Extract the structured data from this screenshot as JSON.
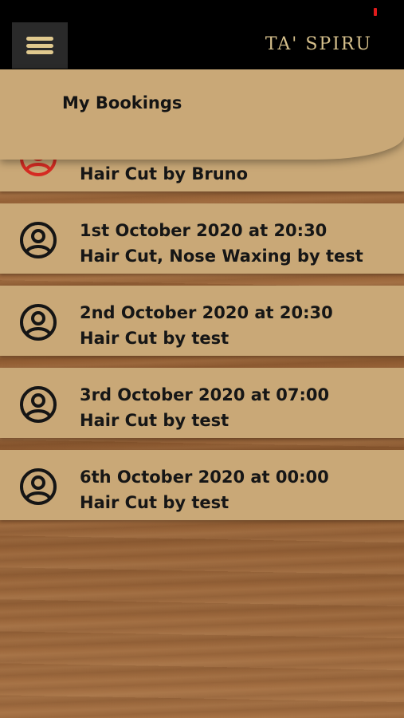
{
  "app": {
    "brand": "TA' SPIRU"
  },
  "header": {
    "title": "My Bookings",
    "menu_icon": "hamburger-icon"
  },
  "bookings": [
    {
      "line1": "",
      "line2": "Hair Cut by Bruno",
      "icon": "user-circle-icon",
      "icon_color": "#d52b22"
    },
    {
      "line1": "1st October 2020 at 20:30",
      "line2": "Hair Cut, Nose Waxing by test",
      "icon": "user-circle-icon",
      "icon_color": "#151515"
    },
    {
      "line1": "2nd October 2020 at 20:30",
      "line2": "Hair Cut by test",
      "icon": "user-circle-icon",
      "icon_color": "#151515"
    },
    {
      "line1": "3rd October 2020 at 07:00",
      "line2": "Hair Cut by test",
      "icon": "user-circle-icon",
      "icon_color": "#151515"
    },
    {
      "line1": "6th October 2020 at 00:00",
      "line2": "Hair Cut by test",
      "icon": "user-circle-icon",
      "icon_color": "#151515"
    }
  ],
  "colors": {
    "accent": "#d6c08c",
    "card": "#c9a877",
    "topbar": "#000000",
    "status": "#e01b1b"
  }
}
